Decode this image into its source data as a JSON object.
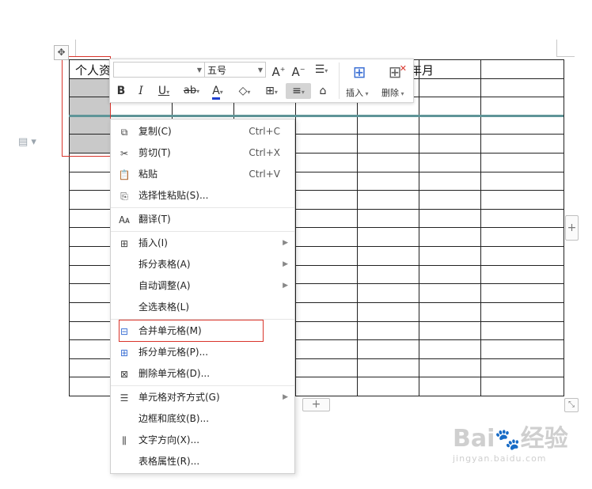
{
  "table": {
    "cell_header_left": "个人资",
    "cell_header_mid": "年月",
    "rows": 18,
    "cols": 8
  },
  "toolbar": {
    "font_name_value": "",
    "font_size_value": "五号",
    "insert_label": "插入",
    "delete_label": "删除"
  },
  "context_menu": {
    "items": [
      {
        "label": "复制(C)",
        "shortcut": "Ctrl+C",
        "icon": "copy-icon"
      },
      {
        "label": "剪切(T)",
        "shortcut": "Ctrl+X",
        "icon": "cut-icon"
      },
      {
        "label": "粘贴",
        "shortcut": "Ctrl+V",
        "icon": "paste-icon"
      },
      {
        "label": "选择性粘贴(S)...",
        "shortcut": "",
        "icon": "paste-special-icon"
      },
      {
        "label": "翻译(T)",
        "shortcut": "",
        "icon": "translate-icon"
      },
      {
        "label": "插入(I)",
        "shortcut": "",
        "icon": "insert-table-icon"
      },
      {
        "label": "拆分表格(A)",
        "shortcut": "",
        "icon": ""
      },
      {
        "label": "自动调整(A)",
        "shortcut": "",
        "icon": ""
      },
      {
        "label": "全选表格(L)",
        "shortcut": "",
        "icon": ""
      },
      {
        "label": "合并单元格(M)",
        "shortcut": "",
        "icon": "merge-cells-icon"
      },
      {
        "label": "拆分单元格(P)...",
        "shortcut": "",
        "icon": "split-cells-icon"
      },
      {
        "label": "删除单元格(D)...",
        "shortcut": "",
        "icon": "delete-cells-icon"
      },
      {
        "label": "单元格对齐方式(G)",
        "shortcut": "",
        "icon": "cell-align-icon"
      },
      {
        "label": "边框和底纹(B)...",
        "shortcut": "",
        "icon": ""
      },
      {
        "label": "文字方向(X)...",
        "shortcut": "",
        "icon": "text-direction-icon"
      },
      {
        "label": "表格属性(R)...",
        "shortcut": "",
        "icon": ""
      }
    ]
  },
  "watermark": {
    "brand": "Bai",
    "brand2": "经验",
    "url": "jingyan.baidu.com"
  },
  "colors": {
    "selection": "#c9c9c9",
    "highlight_red": "#d9342b",
    "teal_line": "#5f9598",
    "font_color_bar": "#1f3fcf"
  }
}
